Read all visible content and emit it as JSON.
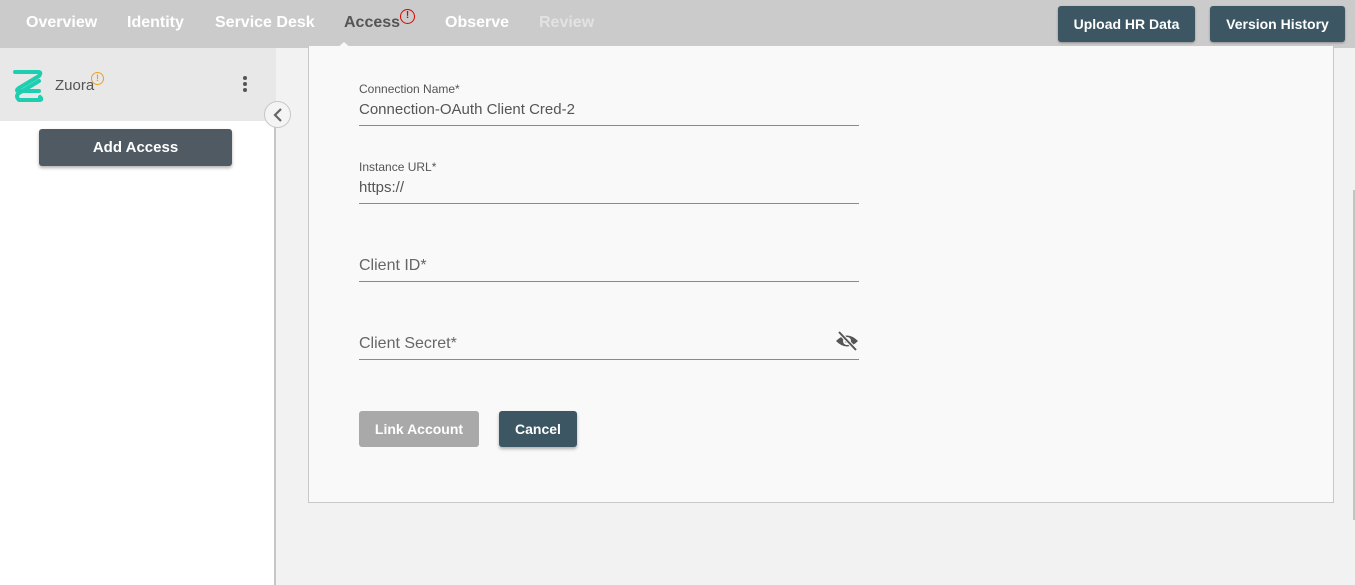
{
  "nav": {
    "tabs": [
      {
        "label": "Overview",
        "state": "normal"
      },
      {
        "label": "Identity",
        "state": "normal"
      },
      {
        "label": "Service Desk",
        "state": "normal"
      },
      {
        "label": "Access",
        "state": "active",
        "badge": "!"
      },
      {
        "label": "Observe",
        "state": "normal"
      },
      {
        "label": "Review",
        "state": "disabled"
      }
    ],
    "buttons": {
      "upload_hr_data": "Upload HR Data",
      "version_history": "Version History"
    },
    "badge_color": "#e00000"
  },
  "sidebar": {
    "app_name": "Zuora",
    "app_warning": "!",
    "logo_icon": "zuora-logo",
    "more_icon": "kebab-menu-icon",
    "add_access_label": "Add Access",
    "collapse_icon": "chevron-left-icon",
    "warning_color": "#f0a020",
    "logo_color": "#1ccfb0"
  },
  "form": {
    "fields": [
      {
        "label": "Connection Name*",
        "value": "Connection-OAuth Client Cred-2"
      },
      {
        "label": "Instance URL*",
        "value": "https://"
      },
      {
        "label": "Client ID*",
        "value": ""
      },
      {
        "label": "Client Secret*",
        "value": "",
        "toggle_icon": "eye-off-icon"
      }
    ],
    "link_account_label": "Link Account",
    "cancel_label": "Cancel",
    "primary_color": "#3c5763",
    "disabled_color": "#a9a9aa"
  }
}
